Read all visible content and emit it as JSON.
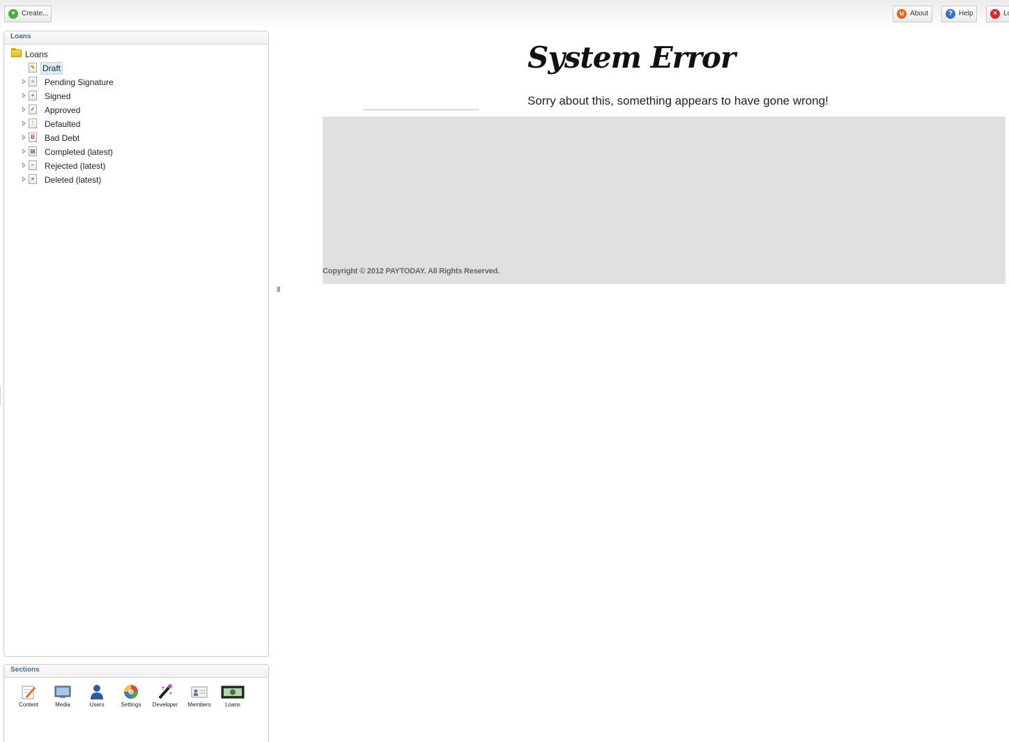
{
  "toolbar": {
    "create_label": "Create...",
    "about_label": "About",
    "help_label": "Help",
    "logout_label": "Lo"
  },
  "tree_panel": {
    "header": "Loans",
    "root": {
      "label": "Loans",
      "icon": "folder-icon"
    },
    "items": [
      {
        "label": "Draft",
        "icon": "draft-doc-icon",
        "selected": true
      },
      {
        "label": "Pending Signature",
        "icon": "pending-doc-icon"
      },
      {
        "label": "Signed",
        "icon": "signed-doc-icon"
      },
      {
        "label": "Approved",
        "icon": "approved-doc-icon"
      },
      {
        "label": "Defaulted",
        "icon": "warning-doc-icon"
      },
      {
        "label": "Bad Debt",
        "icon": "bad-debt-doc-icon"
      },
      {
        "label": "Completed (latest)",
        "icon": "completed-doc-icon"
      },
      {
        "label": "Rejected (latest)",
        "icon": "rejected-doc-icon"
      },
      {
        "label": "Deleted (latest)",
        "icon": "deleted-doc-icon"
      }
    ]
  },
  "sections_panel": {
    "header": "Sections",
    "items": [
      {
        "label": "Content",
        "icon": "content-icon"
      },
      {
        "label": "Media",
        "icon": "media-icon"
      },
      {
        "label": "Users",
        "icon": "users-icon"
      },
      {
        "label": "Settings",
        "icon": "settings-icon"
      },
      {
        "label": "Developer",
        "icon": "developer-icon"
      },
      {
        "label": "Members",
        "icon": "members-icon"
      },
      {
        "label": "Loans",
        "icon": "loans-icon"
      }
    ]
  },
  "error_page": {
    "title": "System Error",
    "message": "Sorry about this, something appears to have gone wrong!",
    "copyright": "Copyright © 2012 PAYTODAY. All Rights Reserved."
  },
  "colors": {
    "panel_header_text": "#3f6f8a",
    "gray_box": "#e0e0e0",
    "selection": "#dcecf9"
  }
}
